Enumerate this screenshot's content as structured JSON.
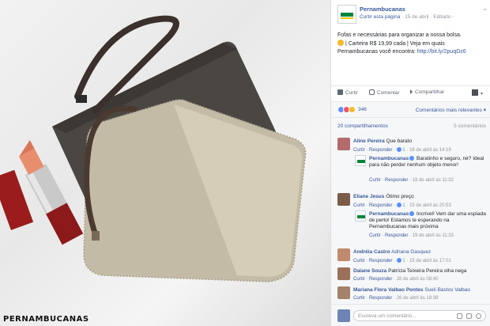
{
  "photo": {
    "brand_watermark": "PERNAMBUCANAS"
  },
  "post": {
    "page_name": "Pernambucanas",
    "follow_link": "Curtir esta página",
    "date": "15 de abril",
    "edited": "Editado",
    "text_line1": "Fofas e necessárias para organizar a nossa bolsa.",
    "text_line2": "| Carteira R$ 19,99 cada | Veja em quais",
    "text_line3_prefix": "Pernambucanas você encontra: ",
    "link": "http://bit.ly/2puqDz6"
  },
  "actions": {
    "like": "Curtir",
    "comment": "Comentar",
    "share": "Compartilhar"
  },
  "reactions": {
    "count": "346",
    "sort": "Comentários mais relevantes"
  },
  "counts": {
    "shares": "20 compartilhamentos",
    "comments": "5 comentários"
  },
  "comments": [
    {
      "name": "Aline Pereira",
      "text": "Que barato",
      "like": "Curtir",
      "reply": "Responder",
      "likes": "1",
      "time": "16 de abril às 14:19",
      "reply_item": {
        "name": "Pernambucanas",
        "text": "Baratinho e seguro, né? Ideal para não perder nenhum objeto menor!",
        "like": "Curtir",
        "reply": "Responder",
        "time": "18 de abril às 11:32"
      }
    },
    {
      "name": "Eliane Jesus",
      "text": "Ótimo preço",
      "like": "Curtir",
      "reply": "Responder",
      "likes": "1",
      "time": "15 de abril às 20:53",
      "reply_item": {
        "name": "Pernambucanas",
        "text": "Incrível! Vem dar uma espiada de perto! Estamos te esperando na Pernambucanas mais próxima",
        "like": "Curtir",
        "reply": "Responder",
        "time": "19 de abril às 11:33"
      }
    },
    {
      "name": "Andréia Castro",
      "text": "Adriana Gasquez",
      "like": "Curtir",
      "reply": "Responder",
      "likes": "1",
      "time": "15 de abril às 17:01"
    },
    {
      "name": "Daiane Souza",
      "text": "Patrícia Teixeira Pereira olha nega",
      "like": "Curtir",
      "reply": "Responder",
      "time": "28 de abril às 08:40"
    },
    {
      "name": "Mariana Flora Valbao Pontes",
      "text": "Sueli Bastos Valbao",
      "like": "Curtir",
      "reply": "Responder",
      "time": "26 de abril às 18:39"
    }
  ],
  "compose": {
    "placeholder": "Escreva um comentário..."
  },
  "colors": {
    "link": "#365899",
    "brand_green": "#00843d",
    "meta_gray": "#90949c"
  }
}
